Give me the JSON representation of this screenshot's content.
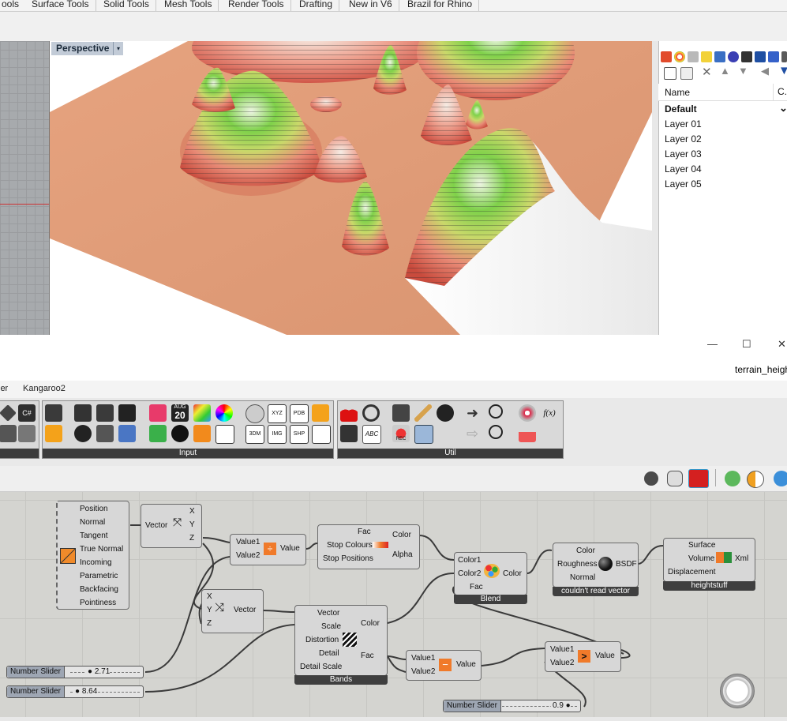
{
  "rhino": {
    "tabs": [
      "ools",
      "Surface Tools",
      "Solid Tools",
      "Mesh Tools",
      "Render Tools",
      "Drafting",
      "New in V6",
      "Brazil for Rhino"
    ],
    "viewport_label": "Perspective",
    "viewport_arrow": "▾"
  },
  "layers": {
    "col_name": "Name",
    "col_c": "C.",
    "default": "Default",
    "chevron": "⌄",
    "items": [
      "Layer 01",
      "Layer 02",
      "Layer 03",
      "Layer 04",
      "Layer 05"
    ]
  },
  "window": {
    "minimize": "—",
    "maximize": "☐",
    "close": "✕",
    "filename": "terrain_heigh"
  },
  "gh": {
    "tabs": [
      "ler",
      "Kangaroo2"
    ],
    "ribbon": {
      "input_caption": "Input",
      "util_caption": "Util",
      "aug": "AUG",
      "aug_num": "20",
      "xyz": "XYZ",
      "pdb": "PDB",
      "3dm": "3DM",
      "img": "IMG",
      "shp": "SHP",
      "abc": "ABC",
      "rec": "REC",
      "fx": "f(x)"
    },
    "components": {
      "geometry": {
        "ports": [
          "Position",
          "Normal",
          "Tangent",
          "True Normal",
          "Incoming",
          "Parametric",
          "Backfacing",
          "Pointiness"
        ]
      },
      "separate": {
        "in": "Vector",
        "out": [
          "X",
          "Y",
          "Z"
        ]
      },
      "divide": {
        "in": [
          "Value1",
          "Value2"
        ],
        "out": "Value"
      },
      "ramp": {
        "in": [
          "Fac",
          "Stop Colours",
          "Stop Positions"
        ],
        "out": [
          "Color",
          "Alpha"
        ]
      },
      "blend": {
        "in": [
          "Color1",
          "Color2",
          "Fac"
        ],
        "out": "Color",
        "caption": "Blend"
      },
      "bsdf": {
        "in": [
          "Color",
          "Roughness",
          "Normal"
        ],
        "out": "BSDF",
        "caption": "couldn't read vector"
      },
      "output": {
        "in": [
          "Surface",
          "Volume",
          "Displacement"
        ],
        "out": "Xml",
        "caption": "heightstuff"
      },
      "combine": {
        "in": [
          "X",
          "Y",
          "Z"
        ],
        "out": "Vector"
      },
      "bands": {
        "in": [
          "Vector",
          "Scale",
          "Distortion",
          "Detail",
          "Detail Scale"
        ],
        "out": [
          "Color",
          "Fac"
        ],
        "caption": "Bands"
      },
      "subtract": {
        "in": [
          "Value1",
          "Value2"
        ],
        "out": "Value"
      },
      "greater": {
        "in": [
          "Value1",
          "Value2"
        ],
        "out": "Value"
      }
    },
    "sliders": [
      {
        "name": "Number Slider",
        "value": "2.71"
      },
      {
        "name": "Number Slider",
        "value": "8.64"
      },
      {
        "name": "Number Slider",
        "value": "0.9"
      }
    ]
  }
}
